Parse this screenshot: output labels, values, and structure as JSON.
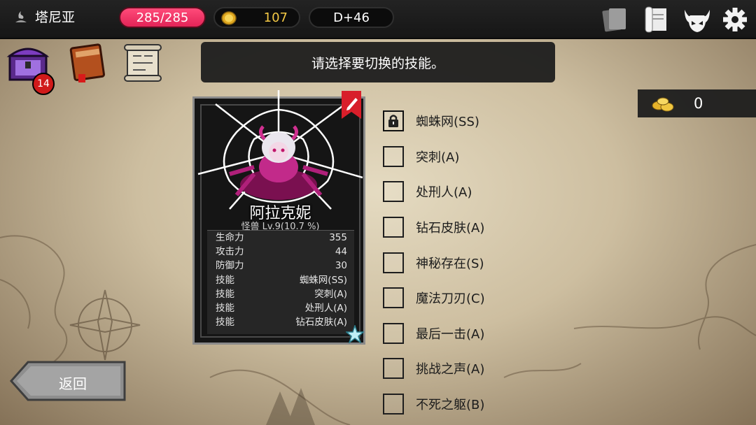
{
  "topbar": {
    "location": "塔尼亚",
    "hp": "285/285",
    "gold": "107",
    "day": "D+46"
  },
  "inventory_badge": "14",
  "banner": "请选择要切换的技能。",
  "gems": "0",
  "character": {
    "name": "阿拉克妮",
    "subtitle": "怪兽 Lv.9(10.7 %)",
    "stats": [
      {
        "label": "生命力",
        "value": "355"
      },
      {
        "label": "攻击力",
        "value": "44"
      },
      {
        "label": "防御力",
        "value": "30"
      },
      {
        "label": "技能",
        "value": "蜘蛛网(SS)"
      },
      {
        "label": "技能",
        "value": "突刺(A)"
      },
      {
        "label": "技能",
        "value": "处刑人(A)"
      },
      {
        "label": "技能",
        "value": "钻石皮肤(A)"
      }
    ]
  },
  "skills": [
    {
      "label": "蜘蛛网(SS)",
      "locked": true
    },
    {
      "label": "突刺(A)",
      "locked": false
    },
    {
      "label": "处刑人(A)",
      "locked": false
    },
    {
      "label": "钻石皮肤(A)",
      "locked": false
    },
    {
      "label": "神秘存在(S)",
      "locked": false
    },
    {
      "label": "魔法刀刃(C)",
      "locked": false
    },
    {
      "label": "最后一击(A)",
      "locked": false
    },
    {
      "label": "挑战之声(A)",
      "locked": false
    },
    {
      "label": "不死之躯(B)",
      "locked": false
    }
  ],
  "back_button": "返回",
  "colors": {
    "hp": "#e22457",
    "gold": "#f3c845",
    "badge": "#d01a1a"
  }
}
